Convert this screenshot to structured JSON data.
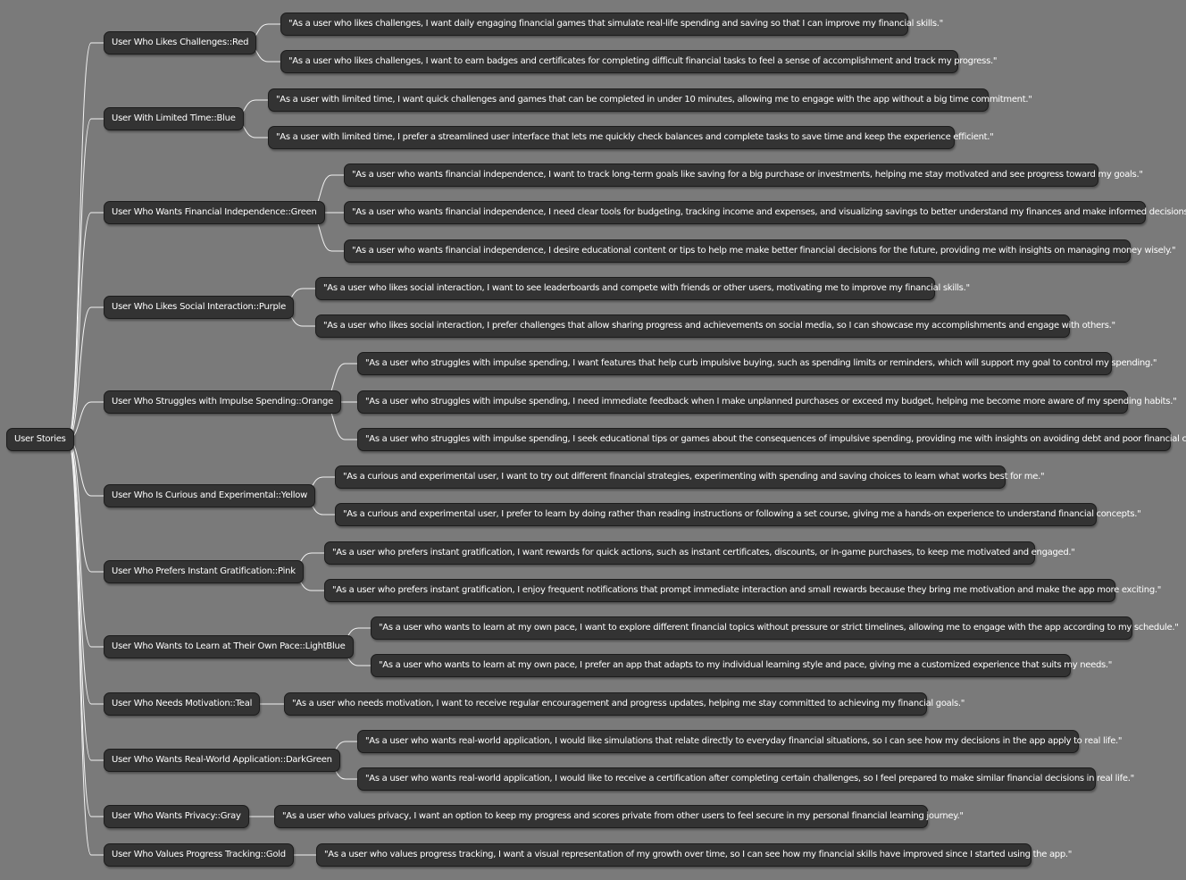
{
  "root": {
    "label": "User Stories"
  },
  "branches": [
    {
      "label": "User Who Likes Challenges::Red",
      "stories": [
        "\"As a user who likes challenges, I want daily engaging financial games that simulate real-life spending and saving so that I can improve my financial skills.\"",
        "\"As a user who likes challenges, I want to earn badges and certificates for completing difficult financial tasks to feel a sense of accomplishment and track my progress.\""
      ]
    },
    {
      "label": "User With Limited Time::Blue",
      "stories": [
        "\"As a user with limited time, I want quick challenges and games that can be completed in under 10 minutes, allowing me to engage with the app without a big time commitment.\"",
        "\"As a user with limited time, I prefer a streamlined user interface that lets me quickly check balances and complete tasks to save time and keep the experience efficient.\""
      ]
    },
    {
      "label": "User Who Wants Financial Independence::Green",
      "stories": [
        "\"As a user who wants financial independence, I want to track long-term goals like saving for a big purchase or investments, helping me stay motivated and see progress toward my goals.\"",
        "\"As a user who wants financial independence, I need clear tools for budgeting, tracking income and expenses, and visualizing savings to better understand my finances and make informed decisions.\"",
        "\"As a user who wants financial independence, I desire educational content or tips to help me make better financial decisions for the future, providing me with insights on managing money wisely.\""
      ]
    },
    {
      "label": "User Who Likes Social Interaction::Purple",
      "stories": [
        "\"As a user who likes social interaction, I want to see leaderboards and compete with friends or other users, motivating me to improve my financial skills.\"",
        "\"As a user who likes social interaction, I prefer challenges that allow sharing progress and achievements on social media, so I can showcase my accomplishments and engage with others.\""
      ]
    },
    {
      "label": "User Who Struggles with Impulse Spending::Orange",
      "stories": [
        "\"As a user who struggles with impulse spending, I want features that help curb impulsive buying, such as spending limits or reminders, which will support my goal to control my spending.\"",
        "\"As a user who struggles with impulse spending, I need immediate feedback when I make unplanned purchases or exceed my budget, helping me become more aware of my spending habits.\"",
        "\"As a user who struggles with impulse spending, I seek educational tips or games about the consequences of impulsive spending, providing me with insights on avoiding debt and poor financial choices.\""
      ]
    },
    {
      "label": "User Who Is Curious and Experimental::Yellow",
      "stories": [
        "\"As a curious and experimental user, I want to try out different financial strategies, experimenting with spending and saving choices to learn what works best for me.\"",
        "\"As a curious and experimental user, I prefer to learn by doing rather than reading instructions or following a set course, giving me a hands-on experience to understand financial concepts.\""
      ]
    },
    {
      "label": "User Who Prefers Instant Gratification::Pink",
      "stories": [
        "\"As a user who prefers instant gratification, I want rewards for quick actions, such as instant certificates, discounts, or in-game purchases, to keep me motivated and engaged.\"",
        "\"As a user who prefers instant gratification, I enjoy frequent notifications that prompt immediate interaction and small rewards because they bring me motivation and make the app more exciting.\""
      ]
    },
    {
      "label": "User Who Wants to Learn at Their Own Pace::LightBlue",
      "stories": [
        "\"As a user who wants to learn at my own pace, I want to explore different financial topics without pressure or strict timelines, allowing me to engage with the app according to my schedule.\"",
        "\"As a user who wants to learn at my own pace, I prefer an app that adapts to my individual learning style and pace, giving me a customized experience that suits my needs.\""
      ]
    },
    {
      "label": "User Who Needs Motivation::Teal",
      "stories": [
        "\"As a user who needs motivation, I want to receive regular encouragement and progress updates, helping me stay committed to achieving my financial goals.\""
      ]
    },
    {
      "label": "User Who Wants Real-World Application::DarkGreen",
      "stories": [
        "\"As a user who wants real-world application, I would like simulations that relate directly to everyday financial situations, so I can see how my decisions in the app apply to real life.\"",
        "\"As a user who wants real-world application, I would like to receive a certification after completing certain challenges, so I feel prepared to make similar financial decisions in real life.\""
      ]
    },
    {
      "label": "User Who Wants Privacy::Gray",
      "stories": [
        "\"As a user who values privacy, I want an option to keep my progress and scores private from other users to feel secure in my personal financial learning journey.\""
      ]
    },
    {
      "label": "User Who Values Progress Tracking::Gold",
      "stories": [
        "\"As a user who values progress tracking, I want a visual representation of my growth over time, so I can see how my financial skills have improved since I started using the app.\""
      ]
    }
  ]
}
